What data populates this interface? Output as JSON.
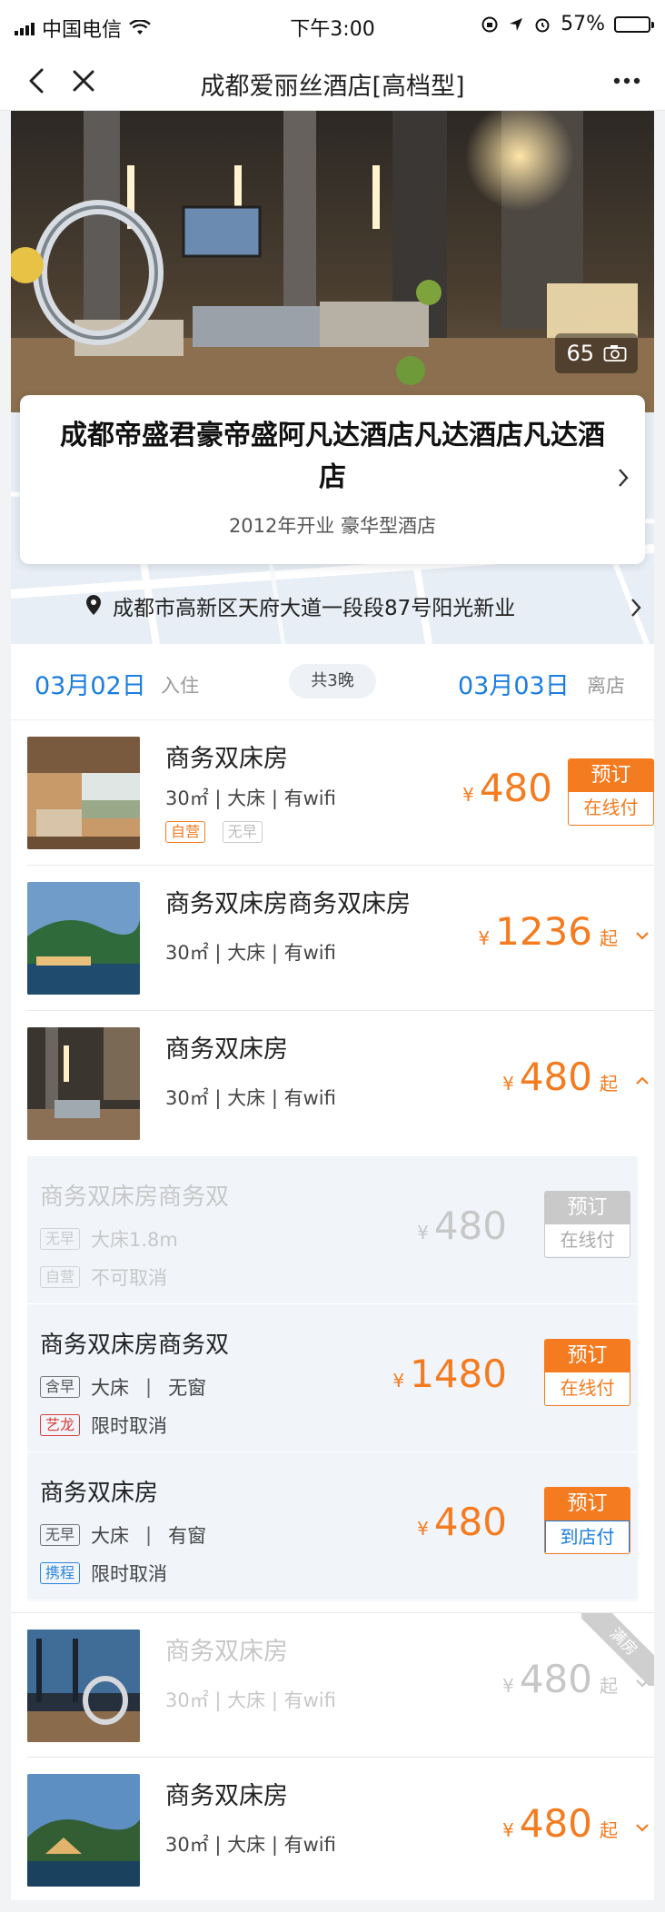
{
  "status_bar": {
    "carrier": "中国电信",
    "time": "下午3:00",
    "battery": "57%",
    "battery_level": 0.57
  },
  "nav": {
    "title": "成都爱丽丝酒店[高档型]"
  },
  "hero": {
    "photo_count": "65"
  },
  "hotel": {
    "name": "成都帝盛君豪帝盛阿凡达酒店凡达酒店凡达酒店",
    "meta": "2012年开业 豪华型酒店",
    "address": "成都市高新区天府大道一段段87号阳光新业"
  },
  "dates": {
    "checkin": "03月02日",
    "checkin_label": "入住",
    "nights": "共3晚",
    "checkout": "03月03日",
    "checkout_label": "离店"
  },
  "rooms": [
    {
      "name": "商务双床房",
      "meta": "30㎡ | 大床 | 有wifi",
      "tags": [
        "自营",
        "无早"
      ],
      "currency": "¥",
      "price": "480",
      "book": "预订",
      "pay": "在线付"
    },
    {
      "name": "商务双床房商务双床房",
      "meta": "30㎡ | 大床 | 有wifi",
      "currency": "¥",
      "price": "1236",
      "suffix": "起"
    },
    {
      "name": "商务双床房",
      "meta": "30㎡ | 大床 | 有wifi",
      "currency": "¥",
      "price": "480",
      "suffix": "起"
    },
    {
      "name": "商务双床房",
      "meta": "30㎡ | 大床 | 有wifi",
      "currency": "¥",
      "price": "480",
      "suffix": "起",
      "badge": "满房"
    },
    {
      "name": "商务双床房",
      "meta": "30㎡ | 大床 | 有wifi",
      "currency": "¥",
      "price": "480",
      "suffix": "起"
    }
  ],
  "plans": [
    {
      "name": "商务双床房商务双",
      "tag1": "无早",
      "detail1": "大床1.8m",
      "tag2": "自营",
      "detail2": "不可取消",
      "currency": "¥",
      "price": "480",
      "book": "预订",
      "pay": "在线付"
    },
    {
      "name": "商务双床房商务双",
      "tag1": "含早",
      "bed": "大床",
      "window": "无窗",
      "tag2": "艺龙",
      "detail2": "限时取消",
      "currency": "¥",
      "price": "1480",
      "book": "预订",
      "pay": "在线付"
    },
    {
      "name": "商务双床房",
      "tag1": "无早",
      "bed": "大床",
      "window": "有窗",
      "tag2": "携程",
      "detail2": "限时取消",
      "currency": "¥",
      "price": "480",
      "book": "预订",
      "pay": "到店付"
    }
  ],
  "colors": {
    "accent_blue": "#1a7de0",
    "accent_orange": "#f47b1f",
    "elong_red": "#d93a3a",
    "ctrip_blue": "#2a86e0"
  }
}
